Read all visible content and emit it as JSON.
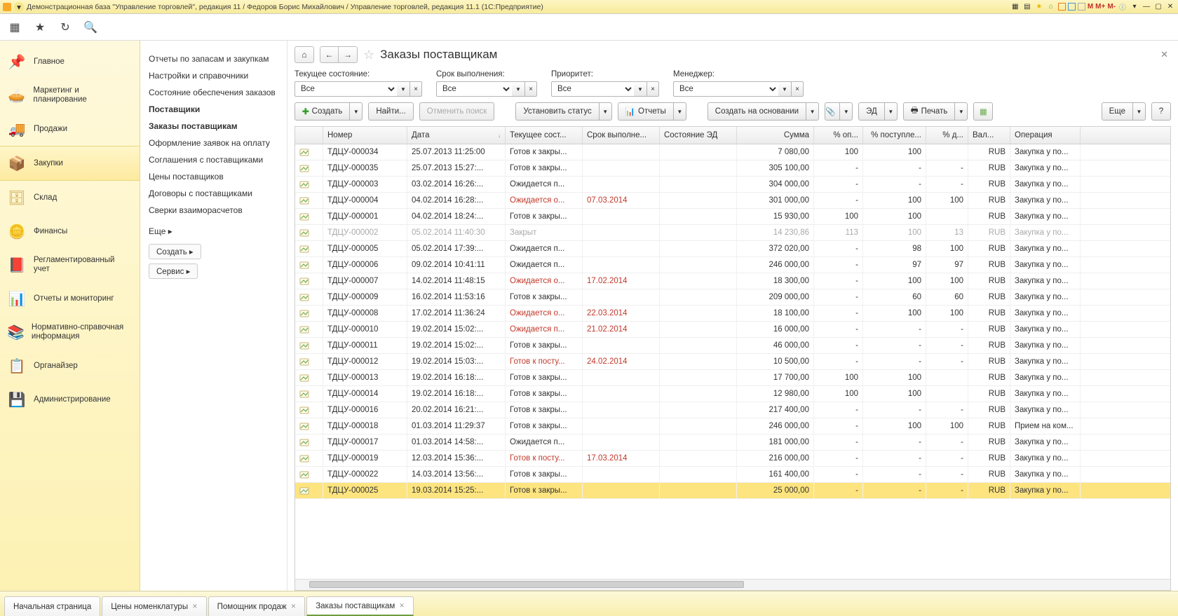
{
  "app": {
    "title": "Демонстрационная база \"Управление торговлей\", редакция 11 / Федоров Борис Михайлович / Управление торговлей, редакция 11.1  (1С:Предприятие)",
    "m_labels": [
      "M",
      "M+",
      "M-"
    ]
  },
  "sidebar": {
    "items": [
      {
        "label": "Главное",
        "icon": "📌",
        "color": "#4aa3d4"
      },
      {
        "label": "Маркетинг и планирование",
        "icon": "🥧",
        "color": "#e57d2f"
      },
      {
        "label": "Продажи",
        "icon": "🚚",
        "color": "#d4a017"
      },
      {
        "label": "Закупки",
        "icon": "📦",
        "color": "#c28a33",
        "active": true
      },
      {
        "label": "Склад",
        "icon": "🗄",
        "color": "#c9a54d"
      },
      {
        "label": "Финансы",
        "icon": "🪙",
        "color": "#b58900"
      },
      {
        "label": "Регламентированный учет",
        "icon": "📕",
        "color": "#b54a3a"
      },
      {
        "label": "Отчеты и мониторинг",
        "icon": "📊",
        "color": "#6aa84f"
      },
      {
        "label": "Нормативно-справочная информация",
        "icon": "📚",
        "color": "#5a8f3e"
      },
      {
        "label": "Органайзер",
        "icon": "📋",
        "color": "#6e9b46"
      },
      {
        "label": "Администрирование",
        "icon": "💾",
        "color": "#d6b84a"
      }
    ]
  },
  "subnav": {
    "items": [
      {
        "label": "Отчеты по запасам и закупкам"
      },
      {
        "label": "Настройки и справочники"
      },
      {
        "label": "Состояние обеспечения заказов"
      },
      {
        "label": "Поставщики",
        "bold": true
      },
      {
        "label": "Заказы поставщикам",
        "bold": true
      },
      {
        "label": "Оформление заявок на оплату"
      },
      {
        "label": "Соглашения с поставщиками"
      },
      {
        "label": "Цены поставщиков"
      },
      {
        "label": "Договоры с поставщиками"
      },
      {
        "label": "Сверки взаиморасчетов"
      }
    ],
    "more": "Еще  ▸",
    "create": "Создать ▸",
    "service": "Сервис ▸"
  },
  "page": {
    "title": "Заказы поставщикам"
  },
  "filters": {
    "state": {
      "label": "Текущее состояние:",
      "value": "Все"
    },
    "deadline": {
      "label": "Срок выполнения:",
      "value": "Все"
    },
    "priority": {
      "label": "Приоритет:",
      "value": "Все"
    },
    "manager": {
      "label": "Менеджер:",
      "value": "Все"
    }
  },
  "cmdbar": {
    "create": "Создать",
    "find": "Найти...",
    "cancel_find": "Отменить поиск",
    "set_status": "Установить статус",
    "reports": "Отчеты",
    "create_based": "Создать на основании",
    "ed": "ЭД",
    "print": "Печать",
    "more": "Еще",
    "help": "?"
  },
  "table": {
    "columns": [
      "",
      "Номер",
      "Дата",
      "Текущее сост...",
      "Срок выполне...",
      "Состояние ЭД",
      "Сумма",
      "% оп...",
      "% поступле...",
      "% д...",
      "Вал...",
      "Операция"
    ],
    "rows": [
      {
        "num": "ТДЦУ-000034",
        "date": "25.07.2013 11:25:00",
        "state": "Готов к закры...",
        "due": "",
        "ed": "",
        "sum": "7 080,00",
        "p1": "100",
        "p2": "100",
        "p3": "",
        "cur": "RUB",
        "op": "Закупка у по..."
      },
      {
        "num": "ТДЦУ-000035",
        "date": "25.07.2013 15:27:...",
        "state": "Готов к закры...",
        "due": "",
        "ed": "",
        "sum": "305 100,00",
        "p1": "-",
        "p2": "-",
        "p3": "-",
        "cur": "RUB",
        "op": "Закупка у по..."
      },
      {
        "num": "ТДЦУ-000003",
        "date": "03.02.2014 16:26:...",
        "state": "Ожидается п...",
        "due": "",
        "ed": "",
        "sum": "304 000,00",
        "p1": "-",
        "p2": "-",
        "p3": "-",
        "cur": "RUB",
        "op": "Закупка у по..."
      },
      {
        "num": "ТДЦУ-000004",
        "date": "04.02.2014 16:28:...",
        "state": "Ожидается о...",
        "state_red": true,
        "due": "07.03.2014",
        "due_red": true,
        "ed": "",
        "sum": "301 000,00",
        "p1": "-",
        "p2": "100",
        "p3": "100",
        "cur": "RUB",
        "op": "Закупка у по..."
      },
      {
        "num": "ТДЦУ-000001",
        "date": "04.02.2014 18:24:...",
        "state": "Готов к закры...",
        "due": "",
        "ed": "",
        "sum": "15 930,00",
        "p1": "100",
        "p2": "100",
        "p3": "",
        "cur": "RUB",
        "op": "Закупка у по..."
      },
      {
        "num": "ТДЦУ-000002",
        "date": "05.02.2014 11:40:30",
        "state": "Закрыт",
        "due": "",
        "ed": "",
        "sum": "14 230,86",
        "p1": "113",
        "p2": "100",
        "p3": "13",
        "cur": "RUB",
        "op": "Закупка у по...",
        "closed": true
      },
      {
        "num": "ТДЦУ-000005",
        "date": "05.02.2014 17:39:...",
        "state": "Ожидается п...",
        "due": "",
        "ed": "",
        "sum": "372 020,00",
        "p1": "-",
        "p2": "98",
        "p3": "100",
        "cur": "RUB",
        "op": "Закупка у по..."
      },
      {
        "num": "ТДЦУ-000006",
        "date": "09.02.2014 10:41:11",
        "state": "Ожидается п...",
        "due": "",
        "ed": "",
        "sum": "246 000,00",
        "p1": "-",
        "p2": "97",
        "p3": "97",
        "cur": "RUB",
        "op": "Закупка у по..."
      },
      {
        "num": "ТДЦУ-000007",
        "date": "14.02.2014 11:48:15",
        "state": "Ожидается о...",
        "state_red": true,
        "due": "17.02.2014",
        "due_red": true,
        "ed": "",
        "sum": "18 300,00",
        "p1": "-",
        "p2": "100",
        "p3": "100",
        "cur": "RUB",
        "op": "Закупка у по..."
      },
      {
        "num": "ТДЦУ-000009",
        "date": "16.02.2014 11:53:16",
        "state": "Готов к закры...",
        "due": "",
        "ed": "",
        "sum": "209 000,00",
        "p1": "-",
        "p2": "60",
        "p3": "60",
        "cur": "RUB",
        "op": "Закупка у по..."
      },
      {
        "num": "ТДЦУ-000008",
        "date": "17.02.2014 11:36:24",
        "state": "Ожидается о...",
        "state_red": true,
        "due": "22.03.2014",
        "due_red": true,
        "ed": "",
        "sum": "18 100,00",
        "p1": "-",
        "p2": "100",
        "p3": "100",
        "cur": "RUB",
        "op": "Закупка у по..."
      },
      {
        "num": "ТДЦУ-000010",
        "date": "19.02.2014 15:02:...",
        "state": "Ожидается п...",
        "state_red": true,
        "due": "21.02.2014",
        "due_red": true,
        "ed": "",
        "sum": "16 000,00",
        "p1": "-",
        "p2": "-",
        "p3": "-",
        "cur": "RUB",
        "op": "Закупка у по..."
      },
      {
        "num": "ТДЦУ-000011",
        "date": "19.02.2014 15:02:...",
        "state": "Готов к закры...",
        "due": "",
        "ed": "",
        "sum": "46 000,00",
        "p1": "-",
        "p2": "-",
        "p3": "-",
        "cur": "RUB",
        "op": "Закупка у по..."
      },
      {
        "num": "ТДЦУ-000012",
        "date": "19.02.2014 15:03:...",
        "state": "Готов к посту...",
        "state_red": true,
        "due": "24.02.2014",
        "due_red": true,
        "ed": "",
        "sum": "10 500,00",
        "p1": "-",
        "p2": "-",
        "p3": "-",
        "cur": "RUB",
        "op": "Закупка у по..."
      },
      {
        "num": "ТДЦУ-000013",
        "date": "19.02.2014 16:18:...",
        "state": "Готов к закры...",
        "due": "",
        "ed": "",
        "sum": "17 700,00",
        "p1": "100",
        "p2": "100",
        "p3": "",
        "cur": "RUB",
        "op": "Закупка у по..."
      },
      {
        "num": "ТДЦУ-000014",
        "date": "19.02.2014 16:18:...",
        "state": "Готов к закры...",
        "due": "",
        "ed": "",
        "sum": "12 980,00",
        "p1": "100",
        "p2": "100",
        "p3": "",
        "cur": "RUB",
        "op": "Закупка у по..."
      },
      {
        "num": "ТДЦУ-000016",
        "date": "20.02.2014 16:21:...",
        "state": "Готов к закры...",
        "due": "",
        "ed": "",
        "sum": "217 400,00",
        "p1": "-",
        "p2": "-",
        "p3": "-",
        "cur": "RUB",
        "op": "Закупка у по..."
      },
      {
        "num": "ТДЦУ-000018",
        "date": "01.03.2014 11:29:37",
        "state": "Готов к закры...",
        "due": "",
        "ed": "",
        "sum": "246 000,00",
        "p1": "-",
        "p2": "100",
        "p3": "100",
        "cur": "RUB",
        "op": "Прием на ком..."
      },
      {
        "num": "ТДЦУ-000017",
        "date": "01.03.2014 14:58:...",
        "state": "Ожидается п...",
        "due": "",
        "ed": "",
        "sum": "181 000,00",
        "p1": "-",
        "p2": "-",
        "p3": "-",
        "cur": "RUB",
        "op": "Закупка у по..."
      },
      {
        "num": "ТДЦУ-000019",
        "date": "12.03.2014 15:36:...",
        "state": "Готов к посту...",
        "state_red": true,
        "due": "17.03.2014",
        "due_red": true,
        "ed": "",
        "sum": "216 000,00",
        "p1": "-",
        "p2": "-",
        "p3": "-",
        "cur": "RUB",
        "op": "Закупка у по..."
      },
      {
        "num": "ТДЦУ-000022",
        "date": "14.03.2014 13:56:...",
        "state": "Готов к закры...",
        "due": "",
        "ed": "",
        "sum": "161 400,00",
        "p1": "-",
        "p2": "-",
        "p3": "-",
        "cur": "RUB",
        "op": "Закупка у по..."
      },
      {
        "num": "ТДЦУ-000025",
        "date": "19.03.2014 15:25:...",
        "state": "Готов к закры...",
        "due": "",
        "ed": "",
        "sum": "25 000,00",
        "p1": "-",
        "p2": "-",
        "p3": "-",
        "cur": "RUB",
        "op": "Закупка у по...",
        "selected": true
      }
    ]
  },
  "bottom_tabs": [
    {
      "label": "Начальная страница",
      "closable": false
    },
    {
      "label": "Цены номенклатуры",
      "closable": true
    },
    {
      "label": "Помощник продаж",
      "closable": true
    },
    {
      "label": "Заказы поставщикам",
      "closable": true,
      "active": true
    }
  ]
}
